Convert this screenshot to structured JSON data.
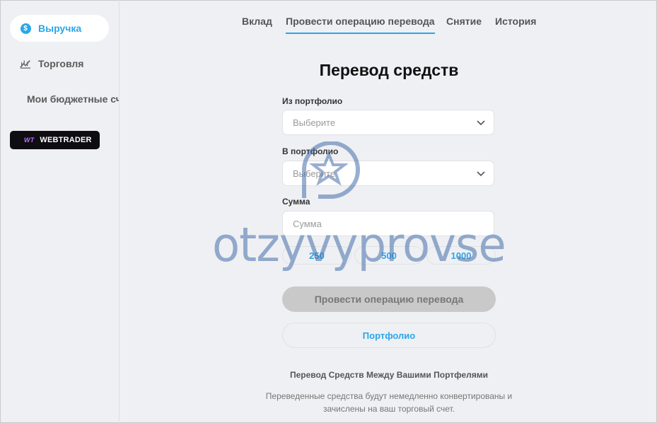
{
  "sidebar": {
    "items": [
      {
        "label": "Выручка",
        "icon": "dollar-icon",
        "active": true
      },
      {
        "label": "Торговля",
        "icon": "chart-icon",
        "active": false
      },
      {
        "label": "Мои бюджетные сч",
        "icon": "",
        "active": false
      }
    ],
    "webtrader": {
      "logo": "WT",
      "label": "WEBTRADER"
    }
  },
  "tabs": [
    {
      "label": "Вклад",
      "active": false
    },
    {
      "label": "Провести операцию перевода",
      "active": true
    },
    {
      "label": "Снятие",
      "active": false
    },
    {
      "label": "История",
      "active": false
    }
  ],
  "form": {
    "title": "Перевод средств",
    "from_label": "Из портфолио",
    "from_value": "Выберите",
    "to_label": "В портфолио",
    "to_value": "Выберите",
    "amount_label": "Сумма",
    "amount_placeholder": "Сумма",
    "quick_amounts": [
      "250",
      "500",
      "1000"
    ],
    "submit_label": "Провести операцию перевода",
    "portfolio_label": "Портфолио"
  },
  "info": {
    "title": "Перевод Средств Между Вашими Портфелями",
    "text": "Переведенные средства будут немедленно конвертированы и зачислены на ваш торговый счет."
  },
  "watermark": {
    "text": "otzyvyprovse"
  },
  "colors": {
    "accent": "#2aa6e9",
    "background": "#eef0f3",
    "disabled": "#c9c9c9"
  }
}
